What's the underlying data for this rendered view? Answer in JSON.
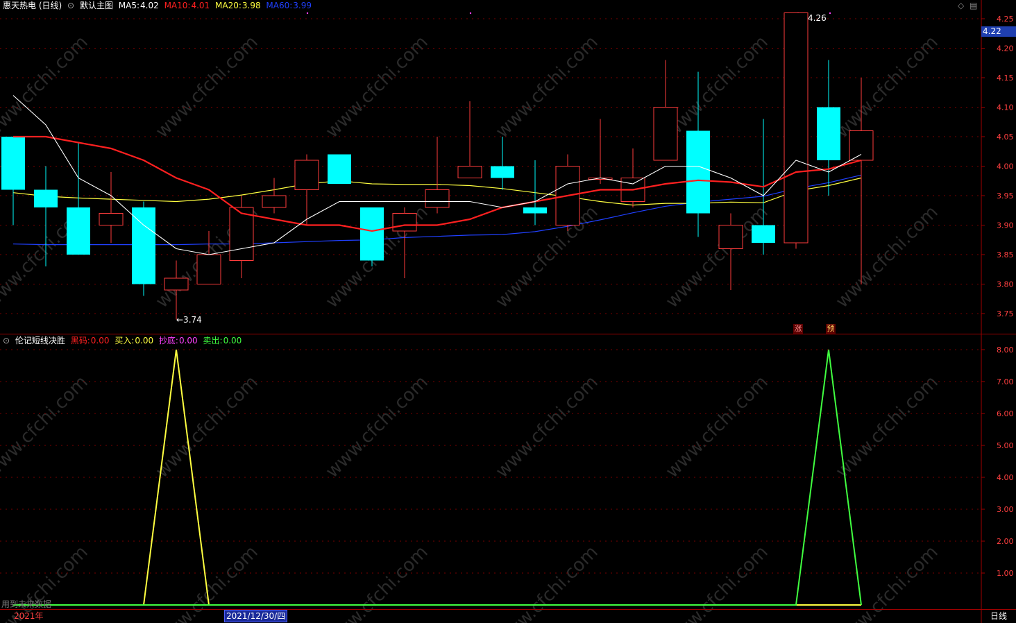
{
  "header": {
    "stock_name": "惠天热电",
    "period": "(日线)",
    "main_chart_label": "默认主图",
    "ma": [
      {
        "label": "MA5:",
        "value": "4.02",
        "color": "#ffffff"
      },
      {
        "label": "MA10:",
        "value": "4.01",
        "color": "#ff2020"
      },
      {
        "label": "MA20:",
        "value": "3.98",
        "color": "#ffff40"
      },
      {
        "label": "MA60:",
        "value": "3.99",
        "color": "#2040ff"
      }
    ]
  },
  "indicator_header": {
    "name": "伦记短线决胜",
    "items": [
      {
        "label": "黑码:",
        "value": "0.00",
        "color": "#ff2020"
      },
      {
        "label": "买入:",
        "value": "0.00",
        "color": "#ffff40"
      },
      {
        "label": "抄底:",
        "value": "0.00",
        "color": "#ff40ff"
      },
      {
        "label": "卖出:",
        "value": "0.00",
        "color": "#40ff40"
      }
    ]
  },
  "annotations": {
    "high_label": "4.26",
    "low_label": "←3.74",
    "current_price": "4.22",
    "tag_rise": "涨",
    "tag_pre": "预",
    "future_data": "用到未来数据"
  },
  "footer": {
    "year": "2021年",
    "date": "2021/12/30/四",
    "period_button": "日线"
  },
  "watermark": "www.cfchi.com",
  "colors": {
    "up": "#ff3c3c",
    "down": "#00ffff",
    "grid": "#7a0000",
    "axis_text": "#ff4040",
    "buy": "#ffff40",
    "sell": "#40ff40"
  },
  "chart_data": [
    {
      "type": "candlestick",
      "title": "惠天热电 (日线)",
      "ylim": [
        3.72,
        4.27
      ],
      "y_ticks": [
        "4.25",
        "4.20",
        "4.15",
        "4.10",
        "4.05",
        "4.00",
        "3.95",
        "3.90",
        "3.85",
        "3.80",
        "3.75"
      ],
      "candles": [
        {
          "o": 4.05,
          "h": 4.05,
          "l": 3.9,
          "c": 3.96
        },
        {
          "o": 3.96,
          "h": 4.0,
          "l": 3.83,
          "c": 3.93
        },
        {
          "o": 3.93,
          "h": 4.04,
          "l": 3.85,
          "c": 3.85
        },
        {
          "o": 3.9,
          "h": 3.99,
          "l": 3.87,
          "c": 3.92
        },
        {
          "o": 3.93,
          "h": 3.94,
          "l": 3.78,
          "c": 3.8
        },
        {
          "o": 3.79,
          "h": 3.84,
          "l": 3.74,
          "c": 3.81
        },
        {
          "o": 3.8,
          "h": 3.89,
          "l": 3.8,
          "c": 3.85
        },
        {
          "o": 3.84,
          "h": 3.95,
          "l": 3.81,
          "c": 3.93
        },
        {
          "o": 3.93,
          "h": 3.98,
          "l": 3.92,
          "c": 3.95
        },
        {
          "o": 3.96,
          "h": 4.02,
          "l": 3.9,
          "c": 4.01
        },
        {
          "o": 4.02,
          "h": 4.02,
          "l": 3.97,
          "c": 3.97
        },
        {
          "o": 3.93,
          "h": 3.93,
          "l": 3.83,
          "c": 3.84
        },
        {
          "o": 3.89,
          "h": 3.93,
          "l": 3.81,
          "c": 3.92
        },
        {
          "o": 3.93,
          "h": 4.05,
          "l": 3.92,
          "c": 3.96
        },
        {
          "o": 3.98,
          "h": 4.11,
          "l": 3.98,
          "c": 4.0
        },
        {
          "o": 4.0,
          "h": 4.05,
          "l": 3.96,
          "c": 3.98
        },
        {
          "o": 3.93,
          "h": 4.01,
          "l": 3.9,
          "c": 3.92
        },
        {
          "o": 3.9,
          "h": 4.02,
          "l": 3.89,
          "c": 4.0
        },
        {
          "o": 3.98,
          "h": 4.08,
          "l": 3.97,
          "c": 3.98
        },
        {
          "o": 3.94,
          "h": 4.03,
          "l": 3.93,
          "c": 3.98
        },
        {
          "o": 4.01,
          "h": 4.18,
          "l": 4.01,
          "c": 4.1
        },
        {
          "o": 4.06,
          "h": 4.16,
          "l": 3.88,
          "c": 3.92
        },
        {
          "o": 3.86,
          "h": 3.92,
          "l": 3.79,
          "c": 3.9
        },
        {
          "o": 3.9,
          "h": 4.08,
          "l": 3.85,
          "c": 3.87
        },
        {
          "o": 3.87,
          "h": 4.26,
          "l": 3.86,
          "c": 4.26
        },
        {
          "o": 4.1,
          "h": 4.18,
          "l": 3.95,
          "c": 4.01
        },
        {
          "o": 4.01,
          "h": 4.15,
          "l": 3.8,
          "c": 4.06
        }
      ],
      "ma5": [
        4.12,
        4.07,
        3.98,
        3.95,
        3.9,
        3.86,
        3.85,
        3.86,
        3.87,
        3.91,
        3.94,
        3.94,
        3.94,
        3.94,
        3.94,
        3.93,
        3.94,
        3.97,
        3.98,
        3.97,
        4.0,
        4.0,
        3.98,
        3.95,
        4.01,
        3.99,
        4.02
      ],
      "ma10": [
        4.05,
        4.05,
        4.04,
        4.03,
        4.01,
        3.98,
        3.96,
        3.92,
        3.91,
        3.9,
        3.9,
        3.89,
        3.9,
        3.9,
        3.91,
        3.93,
        3.94,
        3.95,
        3.96,
        3.96,
        3.97,
        3.976,
        3.973,
        3.965,
        3.99,
        3.995,
        4.01
      ],
      "ma20": [
        3.955,
        3.949,
        3.946,
        3.944,
        3.942,
        3.94,
        3.944,
        3.951,
        3.96,
        3.97,
        3.975,
        3.97,
        3.969,
        3.969,
        3.967,
        3.962,
        3.955,
        3.948,
        3.94,
        3.934,
        3.937,
        3.937,
        3.939,
        3.938,
        3.958,
        3.967,
        3.98
      ],
      "ma60": [
        3.868,
        3.867,
        3.867,
        3.867,
        3.867,
        3.867,
        3.868,
        3.868,
        3.87,
        3.872,
        3.874,
        3.875,
        3.879,
        3.881,
        3.883,
        3.884,
        3.889,
        3.898,
        3.909,
        3.921,
        3.932,
        3.939,
        3.944,
        3.949,
        3.962,
        3.972,
        3.985
      ]
    },
    {
      "type": "line",
      "title": "伦记短线决胜",
      "ylim": [
        0,
        8.15
      ],
      "y_ticks": [
        "8.00",
        "7.00",
        "6.00",
        "5.00",
        "4.00",
        "3.00",
        "2.00",
        "1.00"
      ],
      "series": [
        {
          "name": "买入",
          "values": [
            0,
            0,
            0,
            0,
            0,
            8,
            0,
            0,
            0,
            0,
            0,
            0,
            0,
            0,
            0,
            0,
            0,
            0,
            0,
            0,
            0,
            0,
            0,
            0,
            0,
            0,
            0
          ]
        },
        {
          "name": "卖出",
          "values": [
            0,
            0,
            0,
            0,
            0,
            0,
            0,
            0,
            0,
            0,
            0,
            0,
            0,
            0,
            0,
            0,
            0,
            0,
            0,
            0,
            0,
            0,
            0,
            0,
            0,
            8,
            0
          ]
        }
      ]
    }
  ]
}
